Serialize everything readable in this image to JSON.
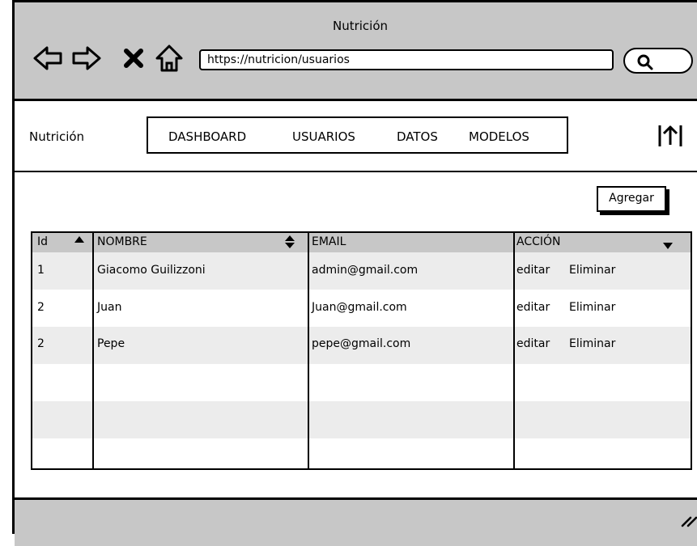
{
  "window": {
    "title": "Nutrición"
  },
  "browser": {
    "url": "https://nutricion/usuarios",
    "icons": [
      "back-icon",
      "forward-icon",
      "stop-icon",
      "home-icon",
      "search-icon"
    ]
  },
  "app": {
    "brand": "Nutrición",
    "tabs": [
      "DASHBOARD",
      "USUARIOS",
      "DATOS",
      "MODELOS"
    ],
    "upload_icon": "upload-icon"
  },
  "toolbar": {
    "add_label": "Agregar"
  },
  "table": {
    "columns": [
      "Id",
      "NOMBRE",
      "EMAIL",
      "ACCIÓN"
    ],
    "rows": [
      {
        "id": "1",
        "nombre": "Giacomo Guilizzoni",
        "email": "admin@gmail.com",
        "edit": "editar",
        "delete": "Eliminar"
      },
      {
        "id": "2",
        "nombre": "Juan",
        "email": "Juan@gmail.com",
        "edit": "editar",
        "delete": "Eliminar"
      },
      {
        "id": "2",
        "nombre": "Pepe",
        "email": "pepe@gmail.com",
        "edit": "editar",
        "delete": "Eliminar"
      }
    ]
  },
  "colors": {
    "chrome": "#c7c7c7",
    "stripe": "#ececec",
    "border": "#000000"
  }
}
